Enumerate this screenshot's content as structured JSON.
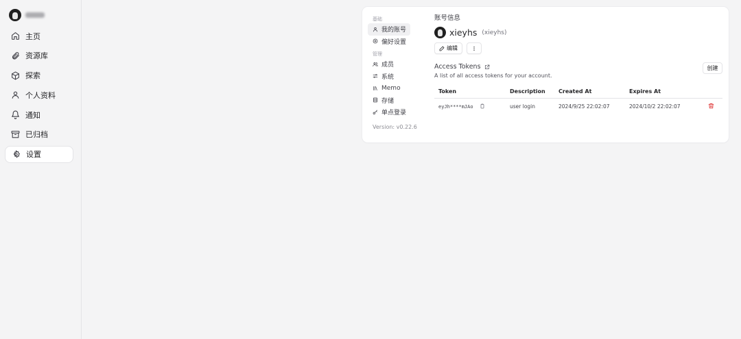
{
  "sidebar": {
    "items": [
      {
        "label": "主页",
        "icon": "home-icon"
      },
      {
        "label": "资源库",
        "icon": "paperclip-icon"
      },
      {
        "label": "探索",
        "icon": "package-icon"
      },
      {
        "label": "个人资料",
        "icon": "user-icon"
      },
      {
        "label": "通知",
        "icon": "bell-icon"
      },
      {
        "label": "已归档",
        "icon": "archive-icon"
      },
      {
        "label": "设置",
        "icon": "gear-icon",
        "active": true
      }
    ]
  },
  "settings_nav": {
    "basic_label": "基础",
    "basic": [
      {
        "label": "我的账号",
        "icon": "user-icon",
        "active": true
      },
      {
        "label": "偏好设置",
        "icon": "preferences-icon"
      }
    ],
    "admin_label": "管理",
    "admin": [
      {
        "label": "成员",
        "icon": "users-icon"
      },
      {
        "label": "系统",
        "icon": "sliders-icon"
      },
      {
        "label": "Memo",
        "icon": "library-icon"
      },
      {
        "label": "存储",
        "icon": "database-icon"
      },
      {
        "label": "单点登录",
        "icon": "key-icon"
      }
    ],
    "version": "Version: v0.22.6"
  },
  "account": {
    "title": "账号信息",
    "display_name": "xieyhs",
    "handle": "(xieyhs)",
    "edit_label": "编辑"
  },
  "tokens": {
    "title": "Access Tokens",
    "description": "A list of all access tokens for your account.",
    "create_label": "创建",
    "columns": [
      "Token",
      "Description",
      "Created At",
      "Expires At"
    ],
    "rows": [
      {
        "token": "eyJh****mJAo",
        "description": "user login",
        "created_at": "2024/9/25 22:02:07",
        "expires_at": "2024/10/2 22:02:07"
      }
    ]
  },
  "colors": {
    "accent_delete": "#dc2626",
    "background": "#f4f4f5",
    "card": "#ffffff"
  }
}
